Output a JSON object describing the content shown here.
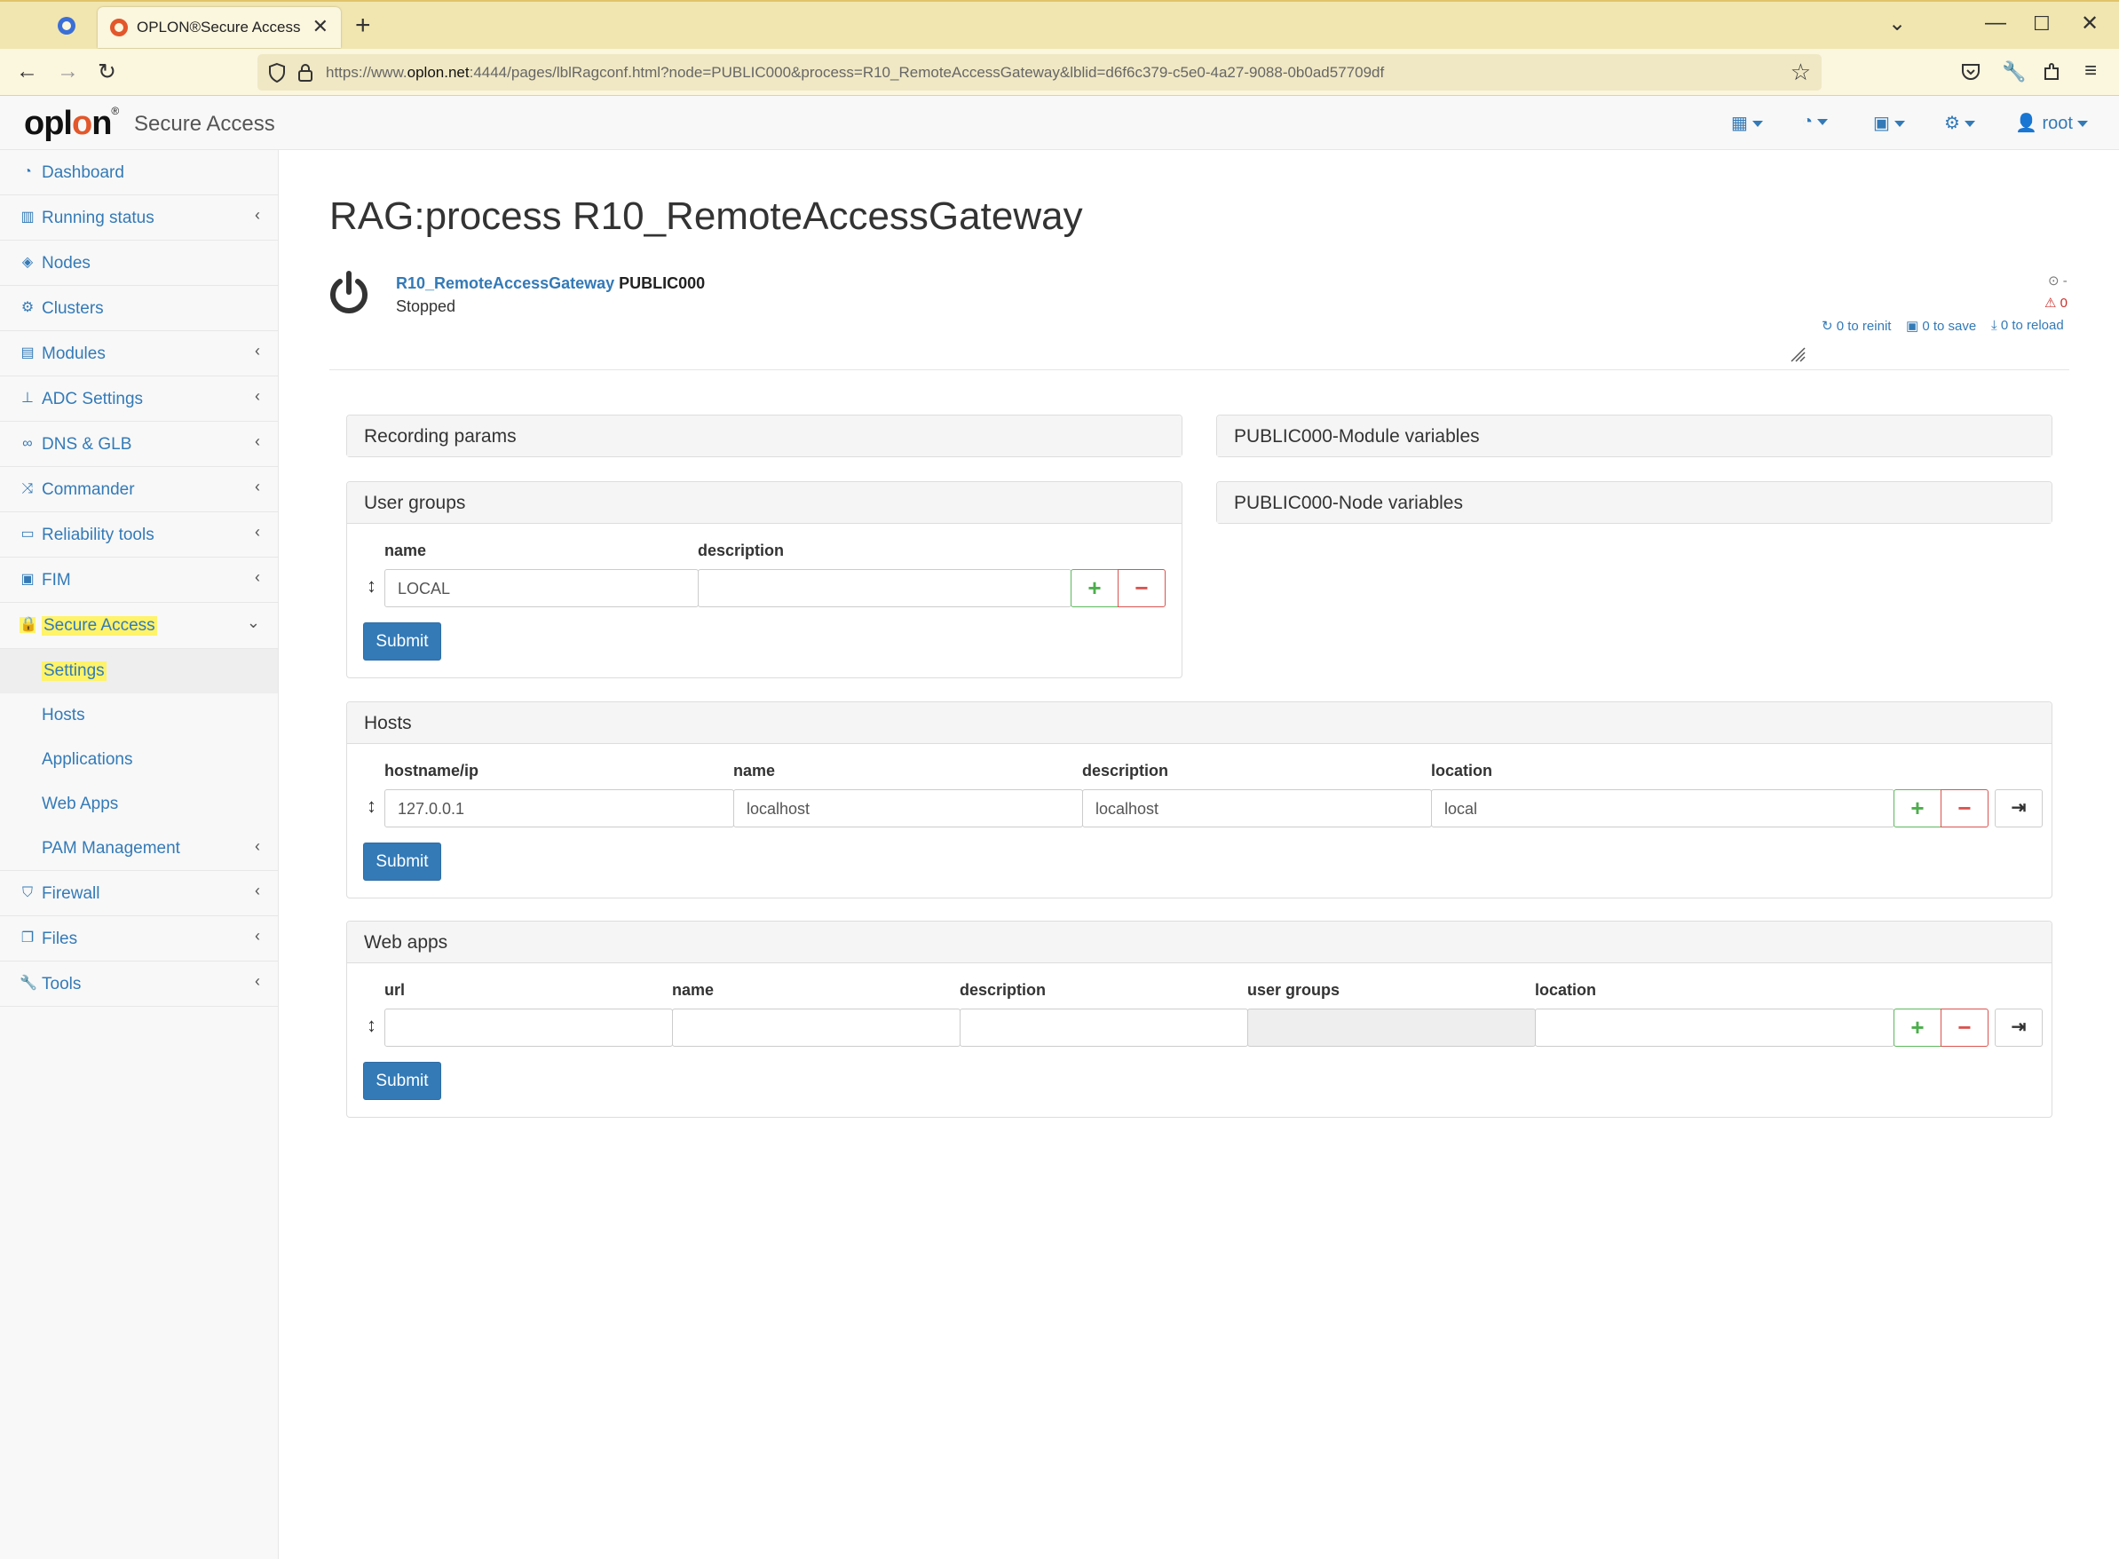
{
  "browser": {
    "tab_title": "OPLON®Secure Access",
    "url_prefix": "https://www.",
    "url_domain": "oplon.net",
    "url_rest": ":4444/pages/lblRagconf.html?node=PUBLIC000&process=R10_RemoteAccessGateway&lblid=d6f6c379-c5e0-4a27-9088-0b0ad57709df"
  },
  "header": {
    "brand": "Secure Access",
    "user": "root"
  },
  "sidebar": {
    "items": [
      {
        "label": "Dashboard",
        "icon": "dashboard-icon"
      },
      {
        "label": "Running status",
        "icon": "bar-chart-icon"
      },
      {
        "label": "Nodes",
        "icon": "cube-icon"
      },
      {
        "label": "Clusters",
        "icon": "cogs-icon"
      },
      {
        "label": "Modules",
        "icon": "list-icon"
      },
      {
        "label": "ADC Settings",
        "icon": "sitemap-icon"
      },
      {
        "label": "DNS & GLB",
        "icon": "binoculars-icon"
      },
      {
        "label": "Commander",
        "icon": "random-icon"
      },
      {
        "label": "Reliability tools",
        "icon": "desktop-icon"
      },
      {
        "label": "FIM",
        "icon": "camera-icon"
      },
      {
        "label": "Secure Access",
        "icon": "lock-icon"
      },
      {
        "label": "Firewall",
        "icon": "shield-icon"
      },
      {
        "label": "Files",
        "icon": "files-icon"
      },
      {
        "label": "Tools",
        "icon": "wrench-icon"
      }
    ],
    "subitems": [
      {
        "label": "Settings"
      },
      {
        "label": "Hosts"
      },
      {
        "label": "Applications"
      },
      {
        "label": "Web Apps"
      },
      {
        "label": "PAM Management"
      }
    ]
  },
  "page": {
    "title": "RAG:process R10_RemoteAccessGateway",
    "process_link": "R10_RemoteAccessGateway",
    "node": "PUBLIC000",
    "status": "Stopped",
    "clock_value": "-",
    "warning_count": "0",
    "reinit": "0 to reinit",
    "save": "0 to save",
    "reload": "0 to reload"
  },
  "panels": {
    "recording": "Recording params",
    "module_vars": "PUBLIC000-Module variables",
    "node_vars": "PUBLIC000-Node variables",
    "user_groups": {
      "title": "User groups",
      "col_name": "name",
      "col_description": "description",
      "row_name": "LOCAL",
      "row_description": "",
      "submit": "Submit"
    },
    "hosts": {
      "title": "Hosts",
      "col_hostname": "hostname/ip",
      "col_name": "name",
      "col_description": "description",
      "col_location": "location",
      "row_hostname": "127.0.0.1",
      "row_name": "localhost",
      "row_description": "localhost",
      "row_location": "local",
      "submit": "Submit"
    },
    "webapps": {
      "title": "Web apps",
      "col_url": "url",
      "col_name": "name",
      "col_description": "description",
      "col_user_groups": "user groups",
      "col_location": "location",
      "submit": "Submit"
    }
  },
  "colors": {
    "link": "#337ab7",
    "submit_bg": "#337ab7",
    "add": "#5cb85c",
    "remove": "#d9534f",
    "highlight": "#fff36a"
  }
}
